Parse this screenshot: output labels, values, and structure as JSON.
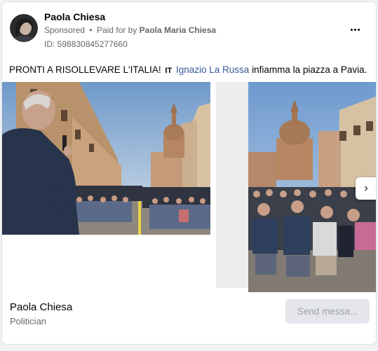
{
  "post": {
    "author": "Paola Chiesa",
    "sponsored_label": "Sponsored",
    "separator": "•",
    "paid_for_prefix": "Paid for by",
    "paid_for_name": "Paola Maria Chiesa",
    "ad_id": "ID: 598830845277660",
    "more_icon": "more-horizontal-icon",
    "text_before": "PRONTI A RISOLLEVARE L'ITALIA!",
    "text_tag": "IT",
    "text_link": "Ignazio La Russa",
    "text_after": "infiamma la piazza a Pavia."
  },
  "carousel": {
    "images": [
      {
        "name": "rally-photo-speaker",
        "subject": "speaker at microphone facing crowd in piazza"
      },
      {
        "name": "rally-photo-crowd",
        "subject": "seated crowd in piazza with cathedral dome"
      }
    ],
    "next_icon": "chevron-right-icon",
    "next_glyph": "›"
  },
  "footer": {
    "page_name": "Paola Chiesa",
    "page_category": "Politician",
    "cta_label": "Send messa..."
  },
  "colors": {
    "link": "#385898",
    "secondary_text": "#65676b",
    "button_bg": "#e4e6eb",
    "button_text_disabled": "#9ea2a8"
  }
}
